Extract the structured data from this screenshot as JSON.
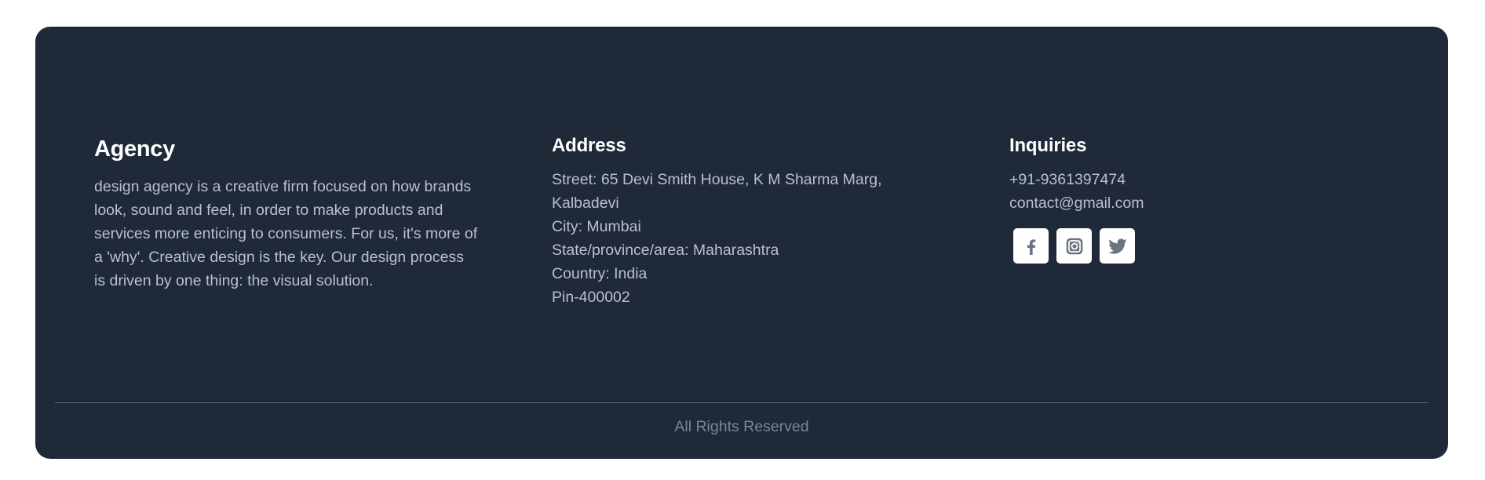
{
  "agency": {
    "title": "Agency",
    "description": "design agency is a creative firm focused on how brands look, sound and feel, in order to make products and services more enticing to consumers. For us, it's more of a 'why'. Creative design is the key. Our design process is driven by one thing: the visual solution."
  },
  "address": {
    "title": "Address",
    "street_line1": "Street: 65 Devi Smith House, K M Sharma Marg,",
    "street_line2": "Kalbadevi",
    "city": "City: Mumbai",
    "state": "State/province/area: Maharashtra",
    "country": "Country: India",
    "pin": "Pin-400002"
  },
  "inquiries": {
    "title": "Inquiries",
    "phone": "+91-9361397474",
    "email": "contact@gmail.com",
    "socials": [
      {
        "icon": "facebook-icon"
      },
      {
        "icon": "instagram-icon"
      },
      {
        "icon": "twitter-icon"
      }
    ]
  },
  "footer": {
    "copyright": "All Rights Reserved"
  },
  "colors": {
    "background": "#1f2937",
    "heading": "#ffffff",
    "text": "#b8c0cc",
    "muted": "#7c8593",
    "icon": "#6b7280"
  }
}
